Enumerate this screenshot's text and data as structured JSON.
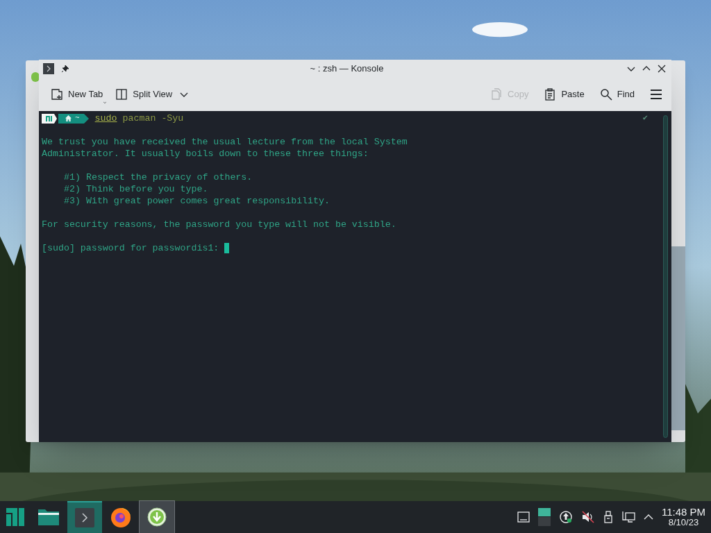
{
  "window": {
    "title": "~ : zsh — Konsole"
  },
  "toolbar": {
    "left": [
      {
        "label": "New Tab",
        "kind": "new-tab",
        "disabled": false
      },
      {
        "label": "Split View",
        "kind": "split-view",
        "disabled": false
      }
    ],
    "right": [
      {
        "label": "Copy",
        "kind": "copy",
        "disabled": true
      },
      {
        "label": "Paste",
        "kind": "paste",
        "disabled": false
      },
      {
        "label": "Find",
        "kind": "find",
        "disabled": false
      }
    ]
  },
  "terminal": {
    "prompt": {
      "dir": "~",
      "command": "sudo",
      "args": "pacman -Syu",
      "status": "✔"
    },
    "blocks": [
      {
        "indent": false,
        "lines": [
          "We trust you have received the usual lecture from the local System",
          "Administrator. It usually boils down to these three things:"
        ]
      },
      {
        "indent": true,
        "lines": [
          "#1) Respect the privacy of others.",
          "#2) Think before you type.",
          "#3) With great power comes great responsibility."
        ]
      },
      {
        "indent": false,
        "lines": [
          "For security reasons, the password you type will not be visible."
        ]
      }
    ],
    "input_line": "[sudo] password for passwordis1:"
  },
  "taskbar": {
    "items": [
      {
        "kind": "folder",
        "selected": false,
        "highlighted": false
      },
      {
        "kind": "terminal",
        "selected": true,
        "highlighted": false
      },
      {
        "kind": "firefox",
        "selected": false,
        "highlighted": false
      },
      {
        "kind": "download",
        "selected": false,
        "highlighted": true
      }
    ],
    "clock": {
      "time": "11:48 PM",
      "date": "8/10/23"
    }
  }
}
